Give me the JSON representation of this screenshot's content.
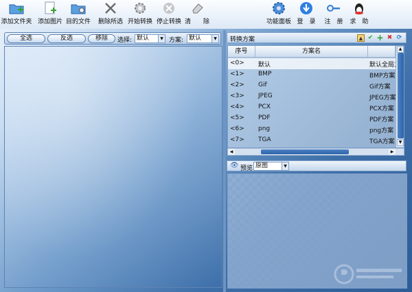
{
  "toolbar": {
    "add_folder": "添加文件夹",
    "add_image": "添加图片",
    "target_folder": "目的文件",
    "delete_selected": "删除所选",
    "start_convert": "开始转换",
    "stop_convert": "停止转换",
    "clear_a": "清",
    "clear_b": "除",
    "function_panel": "功能面板",
    "login_a": "登",
    "login_b": "录",
    "register_a": "注",
    "register_b": "册",
    "help_a": "求",
    "help_b": "助"
  },
  "filter_bar": {
    "select_all": "全选",
    "invert": "反选",
    "remove": "移除",
    "select_label": "选择:",
    "select_value": "默认",
    "scheme_label": "方案:",
    "scheme_value": "默认"
  },
  "scheme_panel": {
    "title": "转换方案",
    "columns": [
      "序号",
      "方案名"
    ],
    "rows": [
      {
        "index": "<0>",
        "name": "默认",
        "desc": "默认全局方案"
      },
      {
        "index": "<1>",
        "name": "BMP",
        "desc": "BMP方案"
      },
      {
        "index": "<2>",
        "name": "Gif",
        "desc": "Gif方案"
      },
      {
        "index": "<3>",
        "name": "JPEG",
        "desc": "JPEG方案"
      },
      {
        "index": "<4>",
        "name": "PCX",
        "desc": "PCX方案"
      },
      {
        "index": "<5>",
        "name": "PDF",
        "desc": "PDF方案"
      },
      {
        "index": "<6>",
        "name": "png",
        "desc": "png方案"
      },
      {
        "index": "<7>",
        "name": "TGA",
        "desc": "TGA方案"
      }
    ]
  },
  "preview": {
    "label": "预览",
    "mode_value": "原图"
  },
  "colors": {
    "accent": "#2e63a9",
    "green_check": "#2a9d2a",
    "red_x": "#d42a2a"
  }
}
